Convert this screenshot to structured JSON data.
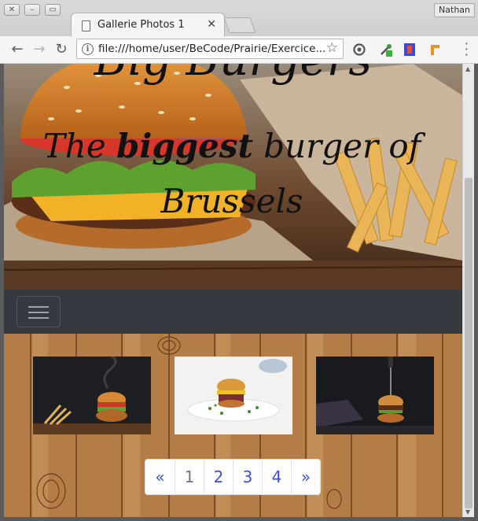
{
  "window": {
    "user": "Nathan"
  },
  "tab": {
    "title": "Gallerie Photos 1"
  },
  "toolbar": {
    "url": "file:///home/user/BeCode/Prairie/Exercice..."
  },
  "hero": {
    "title_top": "Big Burgers",
    "subtitle_before": "The ",
    "subtitle_bold": "biggest",
    "subtitle_after": " burger of Brussels"
  },
  "pagination": {
    "prev": "«",
    "pages": [
      "1",
      "2",
      "3",
      "4"
    ],
    "next": "»",
    "active": "1"
  },
  "colors": {
    "navbar": "#343a40",
    "page_link": "#3d4fd6",
    "wood": "#b07a45"
  }
}
